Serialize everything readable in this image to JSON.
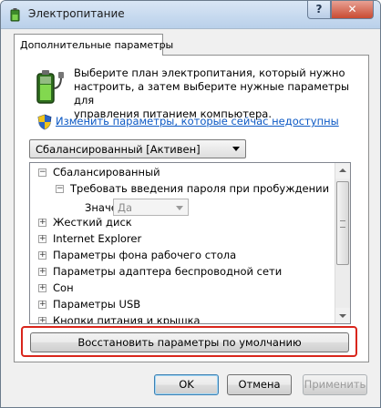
{
  "window": {
    "title": "Электропитание",
    "help_label": "?",
    "close_label": "✕"
  },
  "tab": {
    "label": "Дополнительные параметры"
  },
  "intro": {
    "line1": "Выберите план электропитания, который нужно",
    "line2": "настроить, а затем выберите нужные параметры для",
    "line3": "управления питанием компьютера.",
    "link": "Изменить параметры, которые сейчас недоступны"
  },
  "plan_select": {
    "value": "Сбалансированный [Активен]"
  },
  "tree": {
    "root": {
      "expander": "−",
      "label": "Сбалансированный"
    },
    "child": {
      "expander": "−",
      "label": "Требовать введения пароля при пробуждении"
    },
    "value_label": "Значение:",
    "value": "Да",
    "items": [
      {
        "expander": "+",
        "label": "Жесткий диск"
      },
      {
        "expander": "+",
        "label": "Internet Explorer"
      },
      {
        "expander": "+",
        "label": "Параметры фона рабочего стола"
      },
      {
        "expander": "+",
        "label": "Параметры адаптера беспроводной сети"
      },
      {
        "expander": "+",
        "label": "Сон"
      },
      {
        "expander": "+",
        "label": "Параметры USB"
      },
      {
        "expander": "+",
        "label": "Кнопки питания и крышка"
      }
    ]
  },
  "buttons": {
    "restore": "Восстановить параметры по умолчанию",
    "ok": "OK",
    "cancel": "Отмена",
    "apply": "Применить"
  },
  "colors": {
    "link": "#0b58c4",
    "highlight": "#d9261c"
  },
  "icons": {
    "title": "power-options-icon",
    "battery": "battery-plug-icon",
    "shield": "uac-shield-icon"
  }
}
